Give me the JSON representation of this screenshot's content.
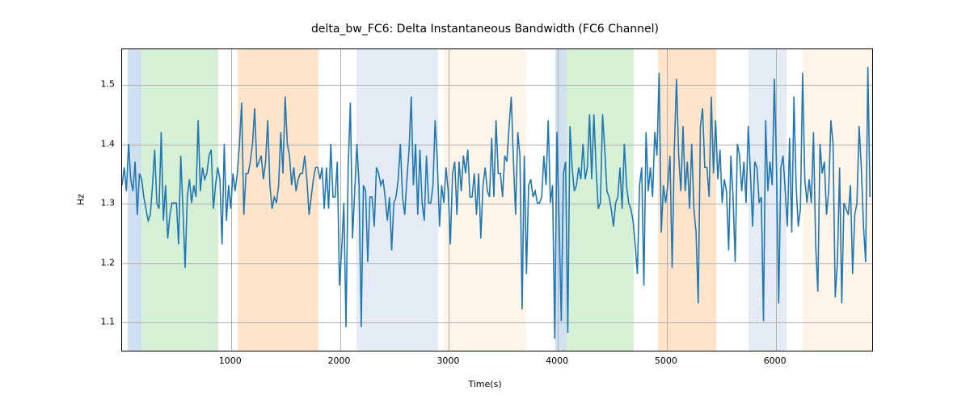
{
  "chart_data": {
    "type": "line",
    "title": "delta_bw_FC6: Delta Instantaneous Bandwidth (FC6 Channel)",
    "xlabel": "Time(s)",
    "ylabel": "Hz",
    "xlim": [
      0,
      6900
    ],
    "ylim": [
      1.05,
      1.56
    ],
    "xticks": [
      1000,
      2000,
      3000,
      4000,
      5000,
      6000
    ],
    "yticks": [
      1.1,
      1.2,
      1.3,
      1.4,
      1.5
    ],
    "line_color": "#1f77b4",
    "bands": [
      {
        "from": 50,
        "to": 180,
        "color": "#6699cc"
      },
      {
        "from": 180,
        "to": 880,
        "color": "#77cc77"
      },
      {
        "from": 1060,
        "to": 1800,
        "color": "#ffa64d"
      },
      {
        "from": 2150,
        "to": 2900,
        "color": "#a7bdd9"
      },
      {
        "from": 2950,
        "to": 3700,
        "color": "#ffd9b3"
      },
      {
        "from": 3980,
        "to": 4080,
        "color": "#6699cc"
      },
      {
        "from": 4080,
        "to": 4700,
        "color": "#77cc77"
      },
      {
        "from": 4920,
        "to": 5450,
        "color": "#ffa64d"
      },
      {
        "from": 5750,
        "to": 6100,
        "color": "#a7bdd9"
      },
      {
        "from": 6250,
        "to": 6900,
        "color": "#ffd9b3"
      }
    ],
    "x": [
      0,
      20,
      40,
      60,
      80,
      100,
      120,
      140,
      160,
      180,
      200,
      220,
      240,
      260,
      280,
      300,
      320,
      340,
      360,
      380,
      400,
      420,
      440,
      460,
      480,
      500,
      520,
      540,
      560,
      580,
      600,
      620,
      640,
      660,
      680,
      700,
      720,
      740,
      760,
      780,
      800,
      820,
      840,
      860,
      880,
      900,
      920,
      940,
      960,
      980,
      1000,
      1020,
      1040,
      1060,
      1080,
      1100,
      1120,
      1140,
      1160,
      1180,
      1200,
      1220,
      1240,
      1260,
      1280,
      1300,
      1320,
      1340,
      1360,
      1380,
      1400,
      1420,
      1440,
      1460,
      1480,
      1500,
      1520,
      1540,
      1560,
      1580,
      1600,
      1620,
      1640,
      1660,
      1680,
      1700,
      1720,
      1740,
      1760,
      1780,
      1800,
      1820,
      1840,
      1860,
      1880,
      1900,
      1920,
      1940,
      1960,
      1980,
      2000,
      2020,
      2040,
      2060,
      2080,
      2100,
      2120,
      2140,
      2160,
      2180,
      2200,
      2220,
      2240,
      2260,
      2280,
      2300,
      2320,
      2340,
      2360,
      2380,
      2400,
      2420,
      2440,
      2460,
      2480,
      2500,
      2520,
      2540,
      2560,
      2580,
      2600,
      2620,
      2640,
      2660,
      2680,
      2700,
      2720,
      2740,
      2760,
      2780,
      2800,
      2820,
      2840,
      2860,
      2880,
      2900,
      2920,
      2940,
      2960,
      2980,
      3000,
      3020,
      3040,
      3060,
      3080,
      3100,
      3120,
      3140,
      3160,
      3180,
      3200,
      3220,
      3240,
      3260,
      3280,
      3300,
      3320,
      3340,
      3360,
      3380,
      3400,
      3420,
      3440,
      3460,
      3480,
      3500,
      3520,
      3540,
      3560,
      3580,
      3600,
      3620,
      3640,
      3660,
      3680,
      3700,
      3720,
      3740,
      3760,
      3780,
      3800,
      3820,
      3840,
      3860,
      3880,
      3900,
      3920,
      3940,
      3960,
      3980,
      4000,
      4020,
      4040,
      4060,
      4080,
      4100,
      4120,
      4140,
      4160,
      4180,
      4200,
      4220,
      4240,
      4260,
      4280,
      4300,
      4320,
      4340,
      4360,
      4380,
      4400,
      4420,
      4440,
      4460,
      4480,
      4500,
      4520,
      4540,
      4560,
      4580,
      4600,
      4620,
      4640,
      4660,
      4680,
      4700,
      4720,
      4740,
      4760,
      4780,
      4800,
      4820,
      4840,
      4860,
      4880,
      4900,
      4920,
      4940,
      4960,
      4980,
      5000,
      5020,
      5040,
      5060,
      5080,
      5100,
      5120,
      5140,
      5160,
      5180,
      5200,
      5220,
      5240,
      5260,
      5280,
      5300,
      5320,
      5340,
      5360,
      5380,
      5400,
      5420,
      5440,
      5460,
      5480,
      5500,
      5520,
      5540,
      5560,
      5580,
      5600,
      5620,
      5640,
      5660,
      5680,
      5700,
      5720,
      5740,
      5760,
      5780,
      5800,
      5820,
      5840,
      5860,
      5880,
      5900,
      5920,
      5940,
      5960,
      5980,
      6000,
      6020,
      6040,
      6060,
      6080,
      6100,
      6120,
      6140,
      6160,
      6180,
      6200,
      6220,
      6240,
      6260,
      6280,
      6300,
      6320,
      6340,
      6360,
      6380,
      6400,
      6420,
      6440,
      6460,
      6480,
      6500,
      6520,
      6540,
      6560,
      6580,
      6600,
      6620,
      6640,
      6660,
      6680,
      6700,
      6720,
      6740,
      6760,
      6780,
      6800,
      6820,
      6840,
      6860,
      6880
    ],
    "values": [
      1.33,
      1.36,
      1.32,
      1.4,
      1.34,
      1.32,
      1.37,
      1.28,
      1.35,
      1.34,
      1.31,
      1.29,
      1.27,
      1.28,
      1.33,
      1.39,
      1.3,
      1.29,
      1.42,
      1.27,
      1.33,
      1.24,
      1.28,
      1.3,
      1.3,
      1.3,
      1.23,
      1.38,
      1.29,
      1.19,
      1.31,
      1.34,
      1.3,
      1.33,
      1.31,
      1.44,
      1.32,
      1.36,
      1.34,
      1.35,
      1.38,
      1.39,
      1.29,
      1.33,
      1.36,
      1.34,
      1.23,
      1.4,
      1.27,
      1.33,
      1.29,
      1.35,
      1.32,
      1.35,
      1.4,
      1.47,
      1.28,
      1.35,
      1.35,
      1.37,
      1.4,
      1.46,
      1.36,
      1.37,
      1.38,
      1.34,
      1.37,
      1.44,
      1.33,
      1.29,
      1.31,
      1.3,
      1.33,
      1.42,
      1.35,
      1.48,
      1.4,
      1.38,
      1.33,
      1.36,
      1.32,
      1.34,
      1.35,
      1.35,
      1.38,
      1.34,
      1.28,
      1.31,
      1.34,
      1.36,
      1.36,
      1.34,
      1.36,
      1.29,
      1.36,
      1.29,
      1.4,
      1.31,
      1.31,
      1.37,
      1.16,
      1.22,
      1.3,
      1.09,
      1.36,
      1.47,
      1.24,
      1.32,
      1.4,
      1.33,
      1.09,
      1.33,
      1.32,
      1.2,
      1.31,
      1.31,
      1.26,
      1.36,
      1.35,
      1.33,
      1.34,
      1.31,
      1.27,
      1.31,
      1.22,
      1.3,
      1.31,
      1.34,
      1.4,
      1.31,
      1.28,
      1.34,
      1.39,
      1.48,
      1.33,
      1.4,
      1.28,
      1.39,
      1.3,
      1.27,
      1.38,
      1.3,
      1.3,
      1.33,
      1.44,
      1.37,
      1.26,
      1.33,
      1.3,
      1.36,
      1.32,
      1.23,
      1.35,
      1.37,
      1.28,
      1.37,
      1.32,
      1.38,
      1.35,
      1.39,
      1.31,
      1.31,
      1.35,
      1.28,
      1.35,
      1.24,
      1.33,
      1.36,
      1.32,
      1.31,
      1.41,
      1.31,
      1.44,
      1.35,
      1.35,
      1.31,
      1.38,
      1.37,
      1.43,
      1.48,
      1.37,
      1.28,
      1.42,
      1.38,
      1.12,
      1.38,
      1.18,
      1.33,
      1.34,
      1.31,
      1.32,
      1.3,
      1.3,
      1.31,
      1.38,
      1.33,
      1.44,
      1.3,
      1.33,
      1.07,
      1.42,
      1.27,
      1.1,
      1.35,
      1.37,
      1.08,
      1.43,
      1.36,
      1.32,
      1.33,
      1.36,
      1.34,
      1.4,
      1.34,
      1.36,
      1.45,
      1.34,
      1.45,
      1.36,
      1.29,
      1.3,
      1.45,
      1.39,
      1.32,
      1.31,
      1.29,
      1.26,
      1.3,
      1.31,
      1.36,
      1.29,
      1.4,
      1.33,
      1.3,
      1.29,
      1.27,
      1.23,
      1.18,
      1.33,
      1.36,
      1.16,
      1.42,
      1.32,
      1.36,
      1.31,
      1.42,
      1.38,
      1.52,
      1.25,
      1.33,
      1.3,
      1.33,
      1.38,
      1.19,
      1.39,
      1.51,
      1.38,
      1.32,
      1.43,
      1.32,
      1.37,
      1.29,
      1.4,
      1.29,
      1.25,
      1.13,
      1.43,
      1.46,
      1.36,
      1.36,
      1.31,
      1.48,
      1.35,
      1.44,
      1.34,
      1.39,
      1.3,
      1.34,
      1.32,
      1.22,
      1.38,
      1.31,
      1.2,
      1.4,
      1.38,
      1.32,
      1.37,
      1.3,
      1.43,
      1.35,
      1.26,
      1.37,
      1.36,
      1.3,
      1.31,
      1.1,
      1.44,
      1.32,
      1.37,
      1.33,
      1.51,
      1.36,
      1.13,
      1.36,
      1.38,
      1.32,
      1.26,
      1.41,
      1.25,
      1.48,
      1.33,
      1.26,
      1.29,
      1.52,
      1.34,
      1.3,
      1.34,
      1.3,
      1.42,
      1.23,
      1.15,
      1.4,
      1.35,
      1.37,
      1.28,
      1.32,
      1.44,
      1.4,
      1.14,
      1.2,
      1.36,
      1.13,
      1.3,
      1.29,
      1.28,
      1.33,
      1.18,
      1.28,
      1.3,
      1.43,
      1.36,
      1.26,
      1.2,
      1.53,
      1.31
    ]
  }
}
